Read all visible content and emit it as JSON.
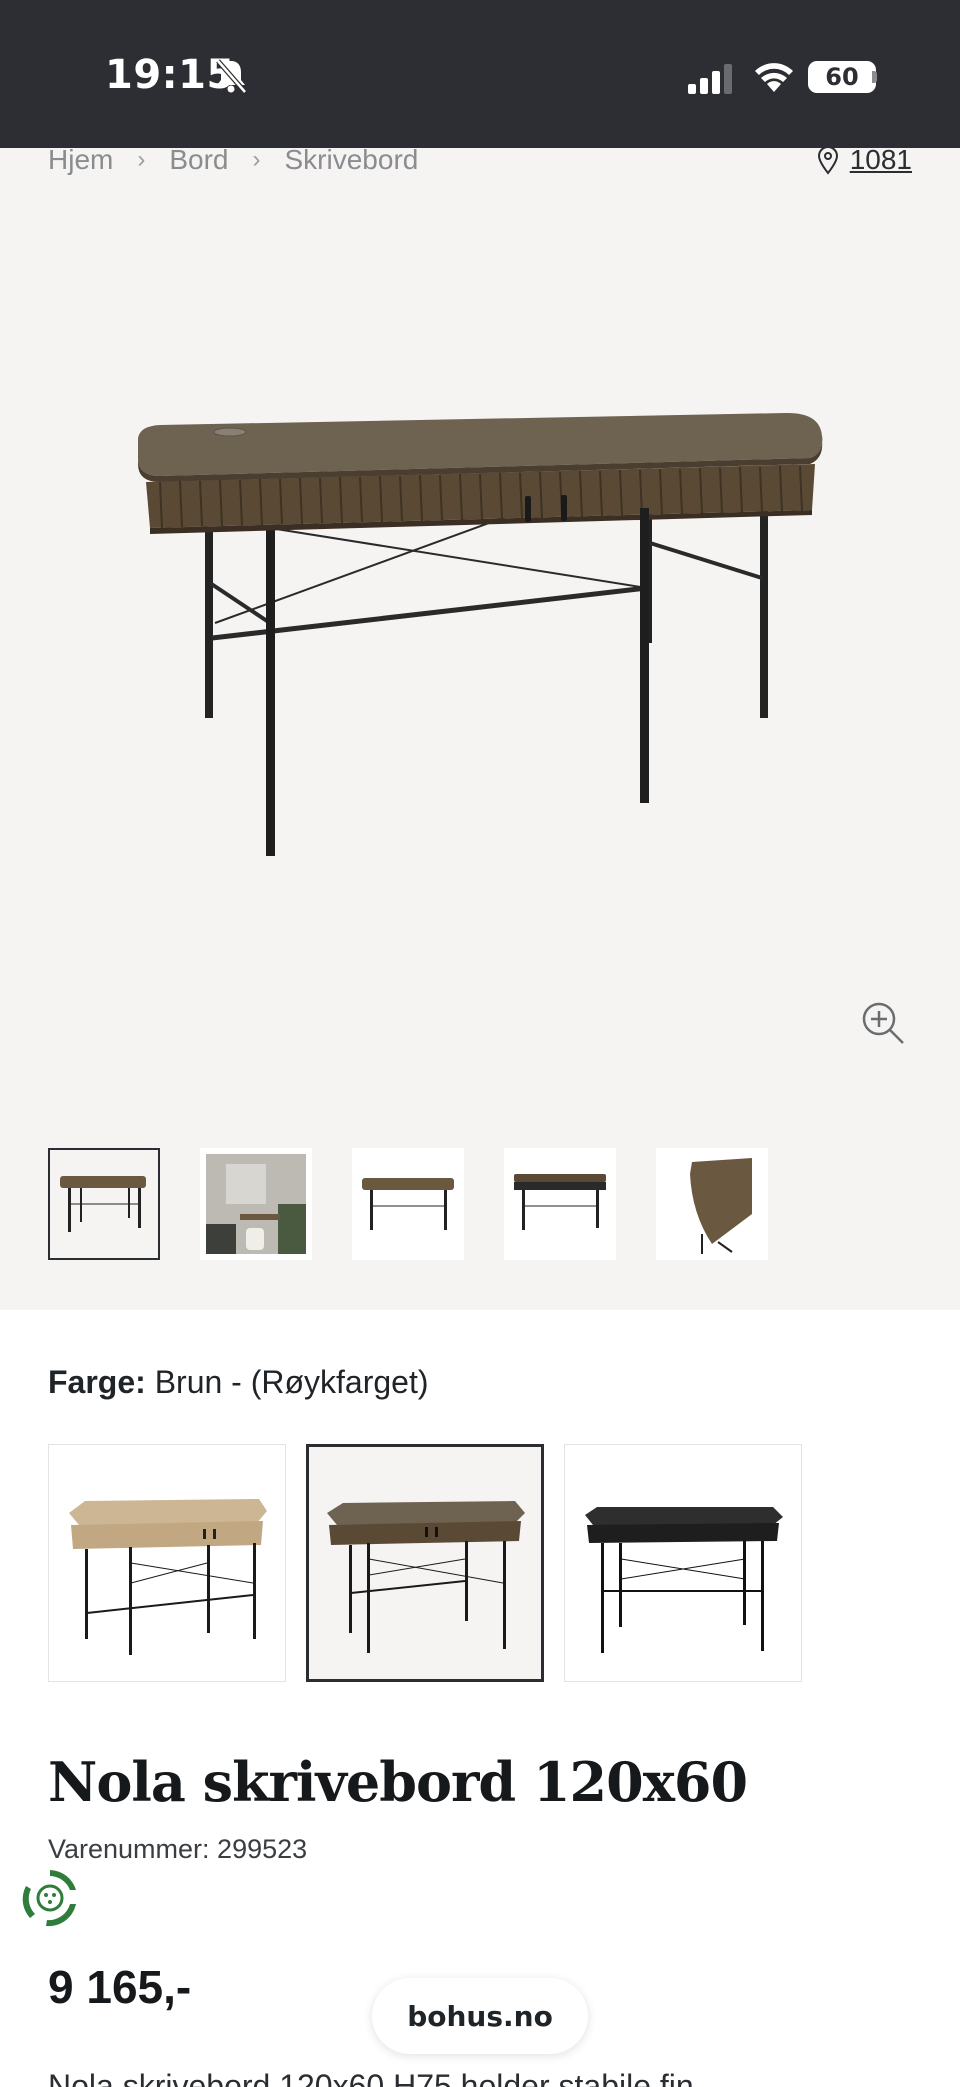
{
  "status_bar": {
    "time": "19:15",
    "battery": "60",
    "icons": [
      "bell-muted-icon",
      "signal-icon",
      "wifi-icon",
      "battery-icon"
    ]
  },
  "breadcrumb": {
    "items": [
      "Hjem",
      "Bord",
      "Skrivebord"
    ],
    "separator": "›"
  },
  "location": {
    "value": "1081",
    "icon": "location-pin-icon"
  },
  "gallery": {
    "zoom_icon": "zoom-in-icon",
    "thumbnails": [
      "desk-front",
      "room-scene",
      "desk-side",
      "desk-open",
      "desk-detail"
    ]
  },
  "color": {
    "label": "Farge:",
    "value": "Brun - (Røykfarget)",
    "options": [
      "oak",
      "brown",
      "black"
    ],
    "selected_index": 1,
    "colors": {
      "oak": "#c9b08c",
      "brown": "#6b5840",
      "black": "#2a2a2a"
    }
  },
  "product": {
    "title": "Nola skrivebord 120x60",
    "sku": "Varenummer: 299523",
    "price": "9 165,-",
    "description": "Nola skrivebord 120x60 H75 holder stabile fin"
  },
  "browser": {
    "url": "bohus.no"
  }
}
